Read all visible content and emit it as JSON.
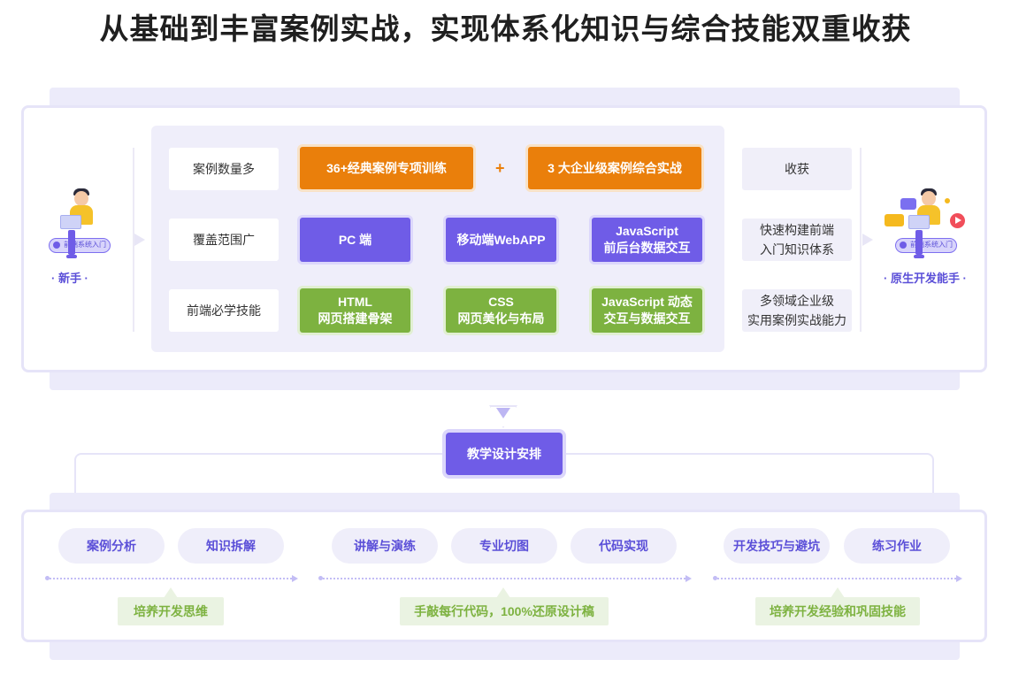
{
  "title": "从基础到丰富案例实战，实现体系化知识与综合技能双重收获",
  "start": {
    "pill_label": "前端系统入门",
    "label": "·  新手  ·"
  },
  "end": {
    "pill_label": "前端系统入门",
    "label": "· 原生开发能手 ·"
  },
  "rows": [
    {
      "label": "案例数量多",
      "boxes": [
        {
          "lines": [
            "36+经典案例专项训练"
          ],
          "color": "orange"
        },
        {
          "lines": [
            "3 大企业级案例综合实战"
          ],
          "color": "orange"
        }
      ],
      "plus": "+"
    },
    {
      "label": "覆盖范围广",
      "boxes": [
        {
          "lines": [
            "PC 端"
          ],
          "color": "purple"
        },
        {
          "lines": [
            "移动端WebAPP"
          ],
          "color": "purple"
        },
        {
          "lines": [
            "JavaScript",
            "前后台数据交互"
          ],
          "color": "purple"
        }
      ]
    },
    {
      "label": "前端必学技能",
      "boxes": [
        {
          "lines": [
            "HTML",
            "网页搭建骨架"
          ],
          "color": "green"
        },
        {
          "lines": [
            "CSS",
            "网页美化与布局"
          ],
          "color": "green"
        },
        {
          "lines": [
            "JavaScript 动态",
            "交互与数据交互"
          ],
          "color": "green"
        }
      ]
    }
  ],
  "results": [
    {
      "lines": [
        "收获"
      ]
    },
    {
      "lines": [
        "快速构建前端",
        "入门知识体系"
      ]
    },
    {
      "lines": [
        "多领域企业级",
        "实用案例实战能力"
      ]
    }
  ],
  "design_button": "教学设计安排",
  "phases": [
    {
      "items": [
        "案例分析",
        "知识拆解"
      ],
      "outcome": "培养开发思维"
    },
    {
      "items": [
        "讲解与演练",
        "专业切图",
        "代码实现"
      ],
      "outcome": "手敲每行代码，100%还原设计稿"
    },
    {
      "items": [
        "开发技巧与避坑",
        "练习作业"
      ],
      "outcome": "培养开发经验和巩固技能"
    }
  ],
  "colors": {
    "orange": "#ea7f0b",
    "purple": "#6f5ce7",
    "green": "#7db240",
    "light_purple": "#efeefa"
  }
}
